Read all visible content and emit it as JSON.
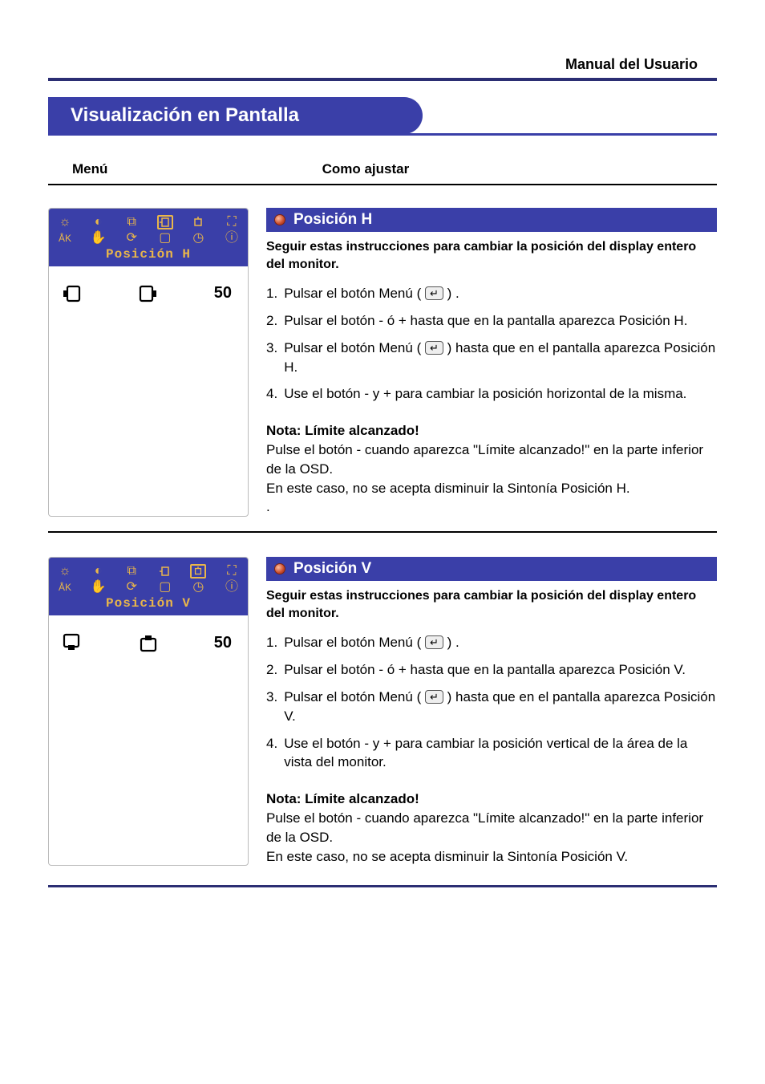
{
  "header": {
    "manual_label": "Manual del Usuario"
  },
  "page_title": "Visualización en Pantalla",
  "columns": {
    "menu": "Menú",
    "como": "Como ajustar"
  },
  "sections": [
    {
      "osd_label": "Posición H",
      "osd_value": "50",
      "topic": "Posición H",
      "intro": "Seguir estas instrucciones para cambiar la posición del display entero del monitor.",
      "steps": [
        {
          "n": "1.",
          "pre": "Pulsar el botón Menú (",
          "post": ") ."
        },
        {
          "n": "2.",
          "text": "Pulsar el botón - ó + hasta que en la pantalla aparezca Posición H."
        },
        {
          "n": "3.",
          "pre": "Pulsar el botón Menú  (",
          "post": ") hasta que en el pantalla aparezca Posición H."
        },
        {
          "n": "4.",
          "text": "Use el botón - y + para cambiar la posición horizontal de la misma."
        }
      ],
      "note": {
        "title": "Nota: Límite alcanzado!",
        "line1": "Pulse el botón - cuando aparezca \"Límite alcanzado!\" en la parte inferior de la OSD.",
        "line2": "En este caso, no se acepta disminuir la Sintonía Posición H."
      }
    },
    {
      "osd_label": "Posición V",
      "osd_value": "50",
      "topic": "Posición V",
      "intro": "Seguir estas instrucciones para cambiar la posición del display entero del monitor.",
      "steps": [
        {
          "n": "1.",
          "pre": "Pulsar el botón Menú (",
          "post": ") ."
        },
        {
          "n": "2.",
          "text": "Pulsar el botón - ó + hasta que en la pantalla aparezca Posición V."
        },
        {
          "n": "3.",
          "pre": "Pulsar el botón Menú (",
          "post": ") hasta que en el pantalla aparezca Posición V."
        },
        {
          "n": "4.",
          "text": "Use el botón - y + para cambiar la posición vertical de la área de la vista del monitor."
        }
      ],
      "note": {
        "title": "Nota: Límite alcanzado!",
        "line1": "Pulse el botón - cuando aparezca \"Límite alcanzado!\" en la parte inferior de la OSD.",
        "line2": "En este caso, no se acepta disminuir la Sintonía Posición V."
      }
    }
  ],
  "icons": {
    "row1": [
      "brightness-icon",
      "contrast-icon",
      "lock-icon",
      "hpos-icon",
      "vpos-icon",
      "expand-icon"
    ],
    "row2": [
      "color-icon",
      "language-icon",
      "reset-icon",
      "geometry-icon",
      "timer-icon",
      "info-icon"
    ]
  },
  "menu_button_glyph": "↵"
}
